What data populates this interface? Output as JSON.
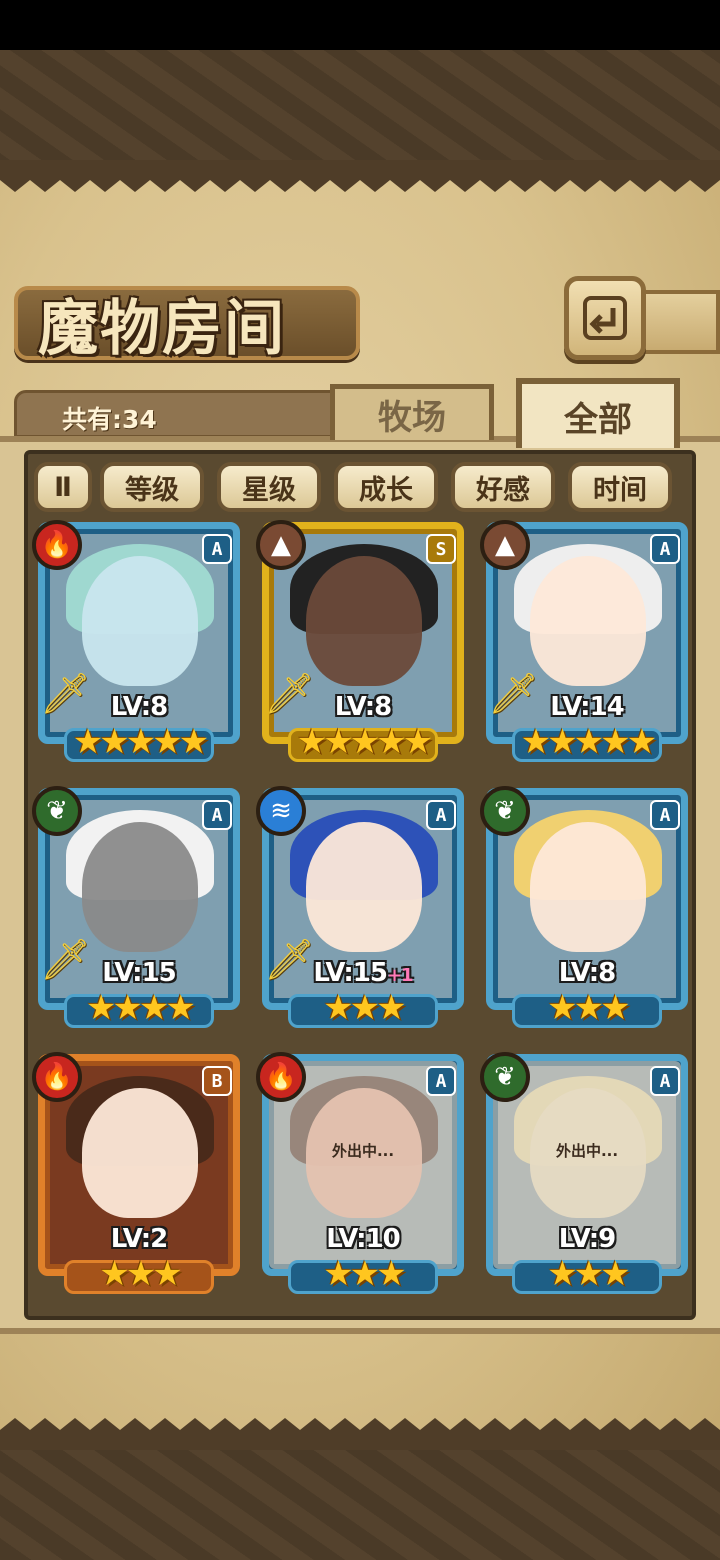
{
  "header": {
    "title": "魔物房间",
    "back_icon": "return-arrow-icon"
  },
  "info": {
    "count_label": "共有:34"
  },
  "tabs": [
    {
      "label": "牧场",
      "active": false
    },
    {
      "label": "全部",
      "active": true
    }
  ],
  "sort": {
    "toggle_label": "Ⅱ",
    "buttons": [
      "等级",
      "星级",
      "成长",
      "好感",
      "时间"
    ]
  },
  "colors": {
    "fire": "#c8261f",
    "earth": "#7a4a33",
    "nature": "#2f6b2c",
    "water": "#2a7fd6",
    "frame_a": "#4fa3cc",
    "frame_s": "#e1b21c",
    "frame_b": "#e0812a",
    "star": "#ffc61f"
  },
  "monsters": [
    {
      "rank": "A",
      "element": "fire",
      "level": "LV:8",
      "plus": "",
      "stars": 5,
      "away": "",
      "equipped": true
    },
    {
      "rank": "S",
      "element": "earth",
      "level": "LV:8",
      "plus": "",
      "stars": 5,
      "away": "",
      "equipped": true
    },
    {
      "rank": "A",
      "element": "earth",
      "level": "LV:14",
      "plus": "",
      "stars": 5,
      "away": "",
      "equipped": true
    },
    {
      "rank": "A",
      "element": "nature",
      "level": "LV:15",
      "plus": "",
      "stars": 4,
      "away": "",
      "equipped": true
    },
    {
      "rank": "A",
      "element": "water",
      "level": "LV:15",
      "plus": "+1",
      "stars": 3,
      "away": "",
      "equipped": true
    },
    {
      "rank": "A",
      "element": "nature",
      "level": "LV:8",
      "plus": "",
      "stars": 3,
      "away": "",
      "equipped": false
    },
    {
      "rank": "B",
      "element": "fire",
      "level": "LV:2",
      "plus": "",
      "stars": 3,
      "away": "",
      "equipped": false
    },
    {
      "rank": "A",
      "element": "fire",
      "level": "LV:10",
      "plus": "",
      "stars": 3,
      "away": "外出中...",
      "equipped": false
    },
    {
      "rank": "A",
      "element": "nature",
      "level": "LV:9",
      "plus": "",
      "stars": 3,
      "away": "外出中...",
      "equipped": false
    }
  ]
}
